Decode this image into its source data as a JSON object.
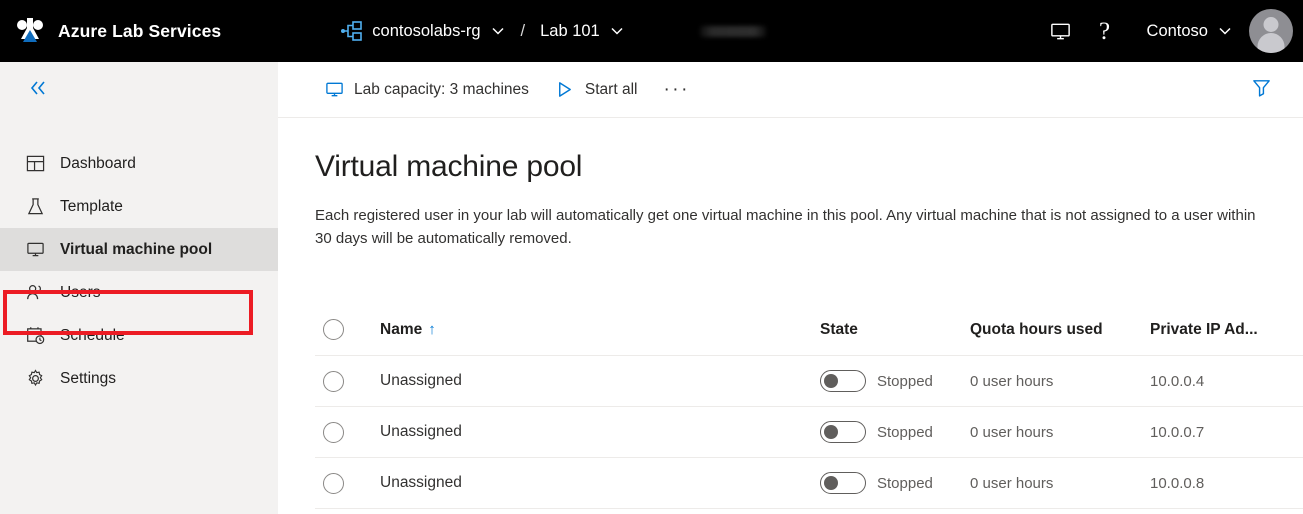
{
  "header": {
    "brand": "Azure Lab Services",
    "brand_logo_icon": "azure-lab-services-logo",
    "breadcrumb": {
      "resource_group_icon": "resource-group-icon",
      "resource_group": "contosolabs-rg",
      "separator": "/",
      "lab": "Lab 101",
      "chevron_icon": "chevron-down-icon"
    },
    "redacted_field": "",
    "feedback_icon": "monitor-icon",
    "help_icon": "?",
    "tenant": "Contoso",
    "tenant_chevron_icon": "chevron-down-icon",
    "avatar_icon": "user-avatar"
  },
  "sidebar": {
    "collapse_icon": "double-chevron-left-icon",
    "items": [
      {
        "label": "Dashboard",
        "icon": "dashboard-icon",
        "selected": false
      },
      {
        "label": "Template",
        "icon": "flask-icon",
        "selected": false
      },
      {
        "label": "Virtual machine pool",
        "icon": "monitor-icon",
        "selected": true
      },
      {
        "label": "Users",
        "icon": "users-icon",
        "selected": false
      },
      {
        "label": "Schedule",
        "icon": "calendar-clock-icon",
        "selected": false
      },
      {
        "label": "Settings",
        "icon": "gear-icon",
        "selected": false
      }
    ],
    "highlight_color": "#ec1c24"
  },
  "command_bar": {
    "lab_capacity": {
      "label": "Lab capacity: 3 machines",
      "icon": "monitor-icon"
    },
    "start_all": {
      "label": "Start all",
      "icon": "play-icon"
    },
    "more_label": "···",
    "filter_icon": "filter-funnel-icon",
    "accent_color": "#0078d4"
  },
  "main": {
    "title": "Virtual machine pool",
    "description": "Each registered user in your lab will automatically get one virtual machine in this pool. Any virtual machine that is not assigned to a user within 30 days will be automatically removed.",
    "table": {
      "columns": {
        "name": "Name",
        "name_sort_indicator": "↑",
        "state": "State",
        "quota": "Quota hours used",
        "ip": "Private IP Ad..."
      },
      "rows": [
        {
          "name": "Unassigned",
          "state": "Stopped",
          "toggle": "off",
          "quota": "0 user hours",
          "ip": "10.0.0.4"
        },
        {
          "name": "Unassigned",
          "state": "Stopped",
          "toggle": "off",
          "quota": "0 user hours",
          "ip": "10.0.0.7"
        },
        {
          "name": "Unassigned",
          "state": "Stopped",
          "toggle": "off",
          "quota": "0 user hours",
          "ip": "10.0.0.8"
        }
      ]
    }
  }
}
